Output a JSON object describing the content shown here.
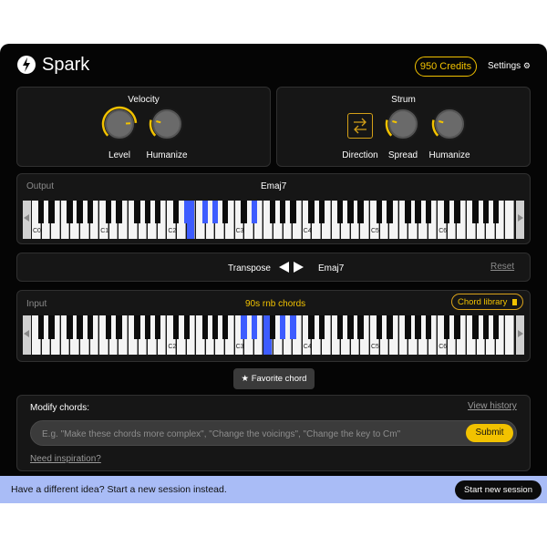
{
  "header": {
    "app_name": "Spark",
    "credits": "950 Credits",
    "settings_label": "Settings",
    "settings_icon": "gear-icon"
  },
  "velocity": {
    "title": "Velocity",
    "knobs": [
      {
        "label": "Level",
        "value": 0.82
      },
      {
        "label": "Humanize",
        "value": 0.22
      }
    ]
  },
  "strum": {
    "title": "Strum",
    "direction_label": "Direction",
    "knobs": [
      {
        "label": "Spread",
        "value": 0.22
      },
      {
        "label": "Humanize",
        "value": 0.22
      }
    ]
  },
  "output": {
    "label": "Output",
    "chord": "Emaj7",
    "octave_labels": [
      "C0",
      "C1",
      "C2",
      "C3",
      "C4",
      "C5",
      "C6"
    ],
    "highlighted_notes": [
      "D#2",
      "E2",
      "F#2",
      "G#2",
      "D#3"
    ]
  },
  "transpose": {
    "label": "Transpose",
    "chord": "Emaj7",
    "reset_label": "Reset"
  },
  "input": {
    "label": "Input",
    "preset": "90s rnb chords",
    "library_label": "Chord library",
    "octave_labels": [
      "C2",
      "C3",
      "C4",
      "C5",
      "C6"
    ],
    "highlighted_notes": [
      "C#3",
      "D#3",
      "F3",
      "G#3",
      "A#3"
    ]
  },
  "favorite": {
    "label": "★ Favorite chord"
  },
  "modify": {
    "label": "Modify chords:",
    "view_history": "View history",
    "placeholder": "E.g. \"Make these chords more complex\", \"Change the voicings\", \"Change the key to Cm\"",
    "value": "",
    "submit": "Submit",
    "inspiration": "Need inspiration?"
  },
  "banner": {
    "text": "Have a different idea? Start a new session instead.",
    "button": "Start new session"
  },
  "colors": {
    "accent": "#f2c200",
    "note_highlight": "#3d5cff",
    "banner_bg": "#a9bcf6"
  }
}
